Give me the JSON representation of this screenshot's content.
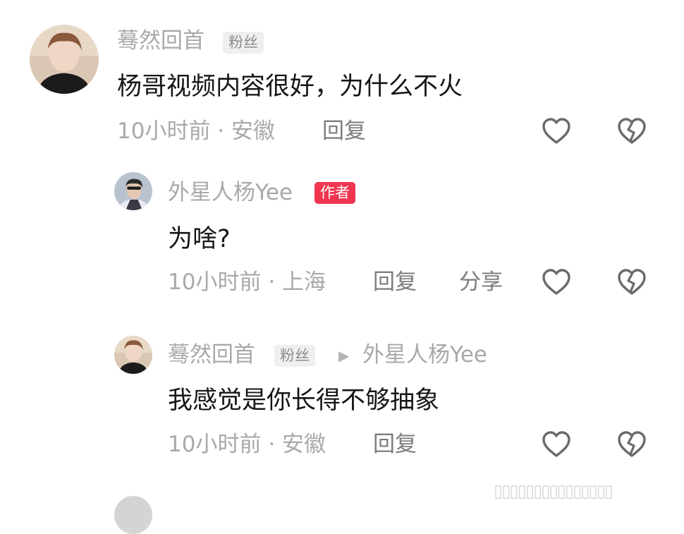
{
  "colors": {
    "author_badge": "#f0354f",
    "secondary_text": "#a9a9a9",
    "primary_text": "#161616"
  },
  "comments": [
    {
      "username": "蓦然回首",
      "badge": "粉丝",
      "text": "杨哥视频内容很好，为什么不火",
      "time": "10小时前",
      "separator": "·",
      "location": "安徽",
      "reply_label": "回复",
      "icons": [
        "heart-icon",
        "broken-heart-icon"
      ]
    },
    {
      "username": "外星人杨Yee",
      "badge": "作者",
      "text": "为啥?",
      "time": "10小时前",
      "separator": "·",
      "location": "上海",
      "reply_label": "回复",
      "share_label": "分享",
      "icons": [
        "heart-icon",
        "broken-heart-icon"
      ]
    },
    {
      "username": "蓦然回首",
      "badge": "粉丝",
      "reply_to": "外星人杨Yee",
      "text": "我感觉是你长得不够抽象",
      "time": "10小时前",
      "separator": "·",
      "location": "安徽",
      "reply_label": "回复",
      "icons": [
        "heart-icon",
        "broken-heart-icon"
      ]
    }
  ],
  "watermark": "▯▯▯▯▯▯▯▯▯▯▯▯▯▯▯"
}
